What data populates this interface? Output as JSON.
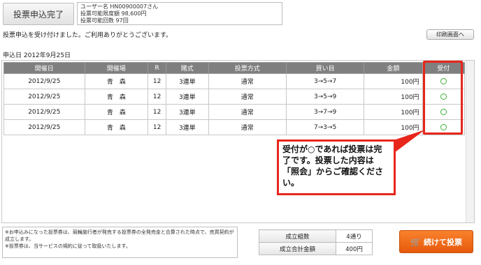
{
  "header": {
    "title": "投票申込完了",
    "user_line": "ユーザー名  HN00900007さん",
    "limit_line": "投票可能限度額  98,600円",
    "count_line": "投票可能回数  97回"
  },
  "message": "投票申込を受け付けました。ご利用ありがとうございます。",
  "print_button": "印刷画面へ",
  "apply_date": "申込日  2012年9月25日",
  "table": {
    "headers": [
      "開催日",
      "開催場",
      "R",
      "賭式",
      "投票方式",
      "買い目",
      "金額",
      "受付"
    ],
    "rows": [
      {
        "date": "2012/9/25",
        "venue": "青　森",
        "race": "12",
        "bet_type": "3連単",
        "method": "通常",
        "pick": "3→5→7",
        "amount": "100円",
        "accepted": "○"
      },
      {
        "date": "2012/9/25",
        "venue": "青　森",
        "race": "12",
        "bet_type": "3連単",
        "method": "通常",
        "pick": "3→5→9",
        "amount": "100円",
        "accepted": "○"
      },
      {
        "date": "2012/9/25",
        "venue": "青　森",
        "race": "12",
        "bet_type": "3連単",
        "method": "通常",
        "pick": "3→7→9",
        "amount": "100円",
        "accepted": "○"
      },
      {
        "date": "2012/9/25",
        "venue": "青　森",
        "race": "12",
        "bet_type": "3連単",
        "method": "通常",
        "pick": "7→3→5",
        "amount": "100円",
        "accepted": "○"
      }
    ]
  },
  "callout": "受付が○であれば投票は完了です。投票した内容は「照会」からご確認ください。",
  "notes": [
    "※お申込みになった投票券は、競輪施行者が発売する投票券の全発売金と合算された時点で、売買契約が成立します。",
    "※投票券は、当サービスの規約に従って取扱いたします。"
  ],
  "summary": {
    "combos_label": "成立組数",
    "combos_value": "4通り",
    "total_label": "成立合計金額",
    "total_value": "400円"
  },
  "continue_button": "続けて投票",
  "icons": {
    "continue": "cart-icon",
    "print": "arrow-right-icon",
    "accepted": "circle-icon"
  },
  "colors": {
    "highlight": "#e8261c",
    "header_bg": "#7f7f7f",
    "continue_bg": "#f27420",
    "accepted": "#3cb034"
  }
}
